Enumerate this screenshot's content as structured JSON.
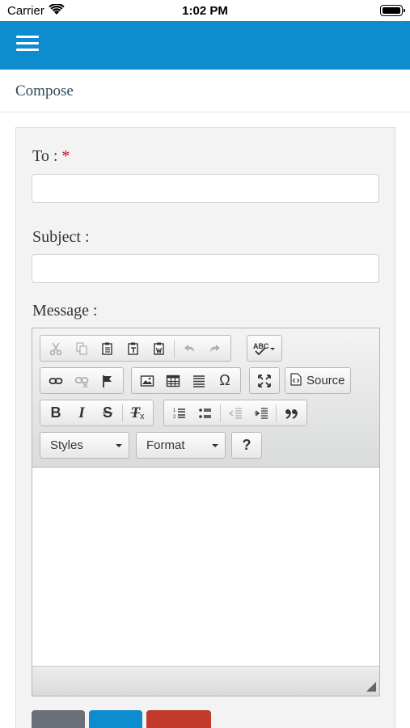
{
  "status_bar": {
    "carrier": "Carrier",
    "time": "1:02 PM"
  },
  "header": {
    "menu_icon": "hamburger-menu-icon",
    "color": "#0d8cd0"
  },
  "page": {
    "title": "Compose"
  },
  "form": {
    "to_label": "To : ",
    "to_required": "*",
    "to_value": "",
    "subject_label": "Subject :",
    "subject_value": "",
    "message_label": "Message :"
  },
  "editor": {
    "toolbar_row1": [
      "cut-icon",
      "copy-icon",
      "paste-icon",
      "paste-text-icon",
      "paste-word-icon",
      "undo-icon",
      "redo-icon",
      "spellcheck-icon"
    ],
    "toolbar_row2": [
      "link-icon",
      "unlink-icon",
      "anchor-icon",
      "image-icon",
      "table-icon",
      "horizontal-line-icon",
      "special-char-icon",
      "maximize-icon",
      "source-icon"
    ],
    "toolbar_row3": [
      "bold-icon",
      "italic-icon",
      "strike-icon",
      "remove-format-icon",
      "numbered-list-icon",
      "bulleted-list-icon",
      "outdent-icon",
      "indent-icon",
      "blockquote-icon"
    ],
    "source_label": "Source",
    "special_char": "Ω",
    "help": "?",
    "styles_label": "Styles",
    "format_label": "Format",
    "body": ""
  },
  "buttons": {
    "colors": [
      "#6b7078",
      "#0d8cd0",
      "#c23a2b"
    ]
  }
}
